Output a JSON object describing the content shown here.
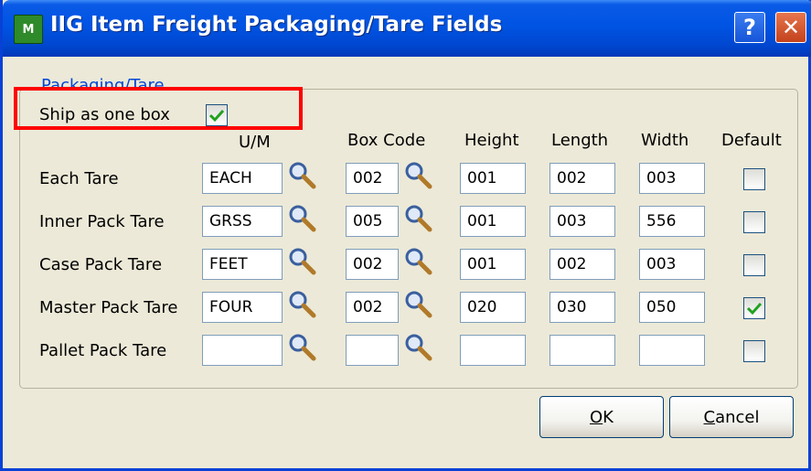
{
  "window": {
    "title": "IIG Item Freight  Packaging/Tare Fields",
    "icon_text": "M",
    "help_label": "?",
    "close_label": "✕"
  },
  "group": {
    "legend": "Packaging/Tare",
    "ship_as_one_box_label": "Ship as one box",
    "ship_as_one_box_checked": true
  },
  "columns": {
    "um": "U/M",
    "box_code": "Box Code",
    "height": "Height",
    "length": "Length",
    "width": "Width",
    "default": "Default"
  },
  "rows": [
    {
      "label": "Each Tare",
      "um": "EACH",
      "box_code": "002",
      "height": "001",
      "length": "002",
      "width": "003",
      "default": false
    },
    {
      "label": "Inner Pack Tare",
      "um": "GRSS",
      "box_code": "005",
      "height": "001",
      "length": "003",
      "width": "556",
      "default": false
    },
    {
      "label": "Case Pack Tare",
      "um": "FEET",
      "box_code": "002",
      "height": "001",
      "length": "002",
      "width": "003",
      "default": false
    },
    {
      "label": "Master Pack Tare",
      "um": "FOUR",
      "box_code": "002",
      "height": "020",
      "length": "030",
      "width": "050",
      "default": true
    },
    {
      "label": "Pallet Pack Tare",
      "um": "",
      "box_code": "",
      "height": "",
      "length": "",
      "width": "",
      "default": false
    }
  ],
  "buttons": {
    "ok_mnemonic": "O",
    "ok_rest": "K",
    "cancel_mnemonic": "C",
    "cancel_rest": "ancel"
  },
  "colors": {
    "titlebar": "#0054e3",
    "highlight_box": "#ff0000",
    "checkmark": "#21a121",
    "legend_text": "#0046d5"
  }
}
